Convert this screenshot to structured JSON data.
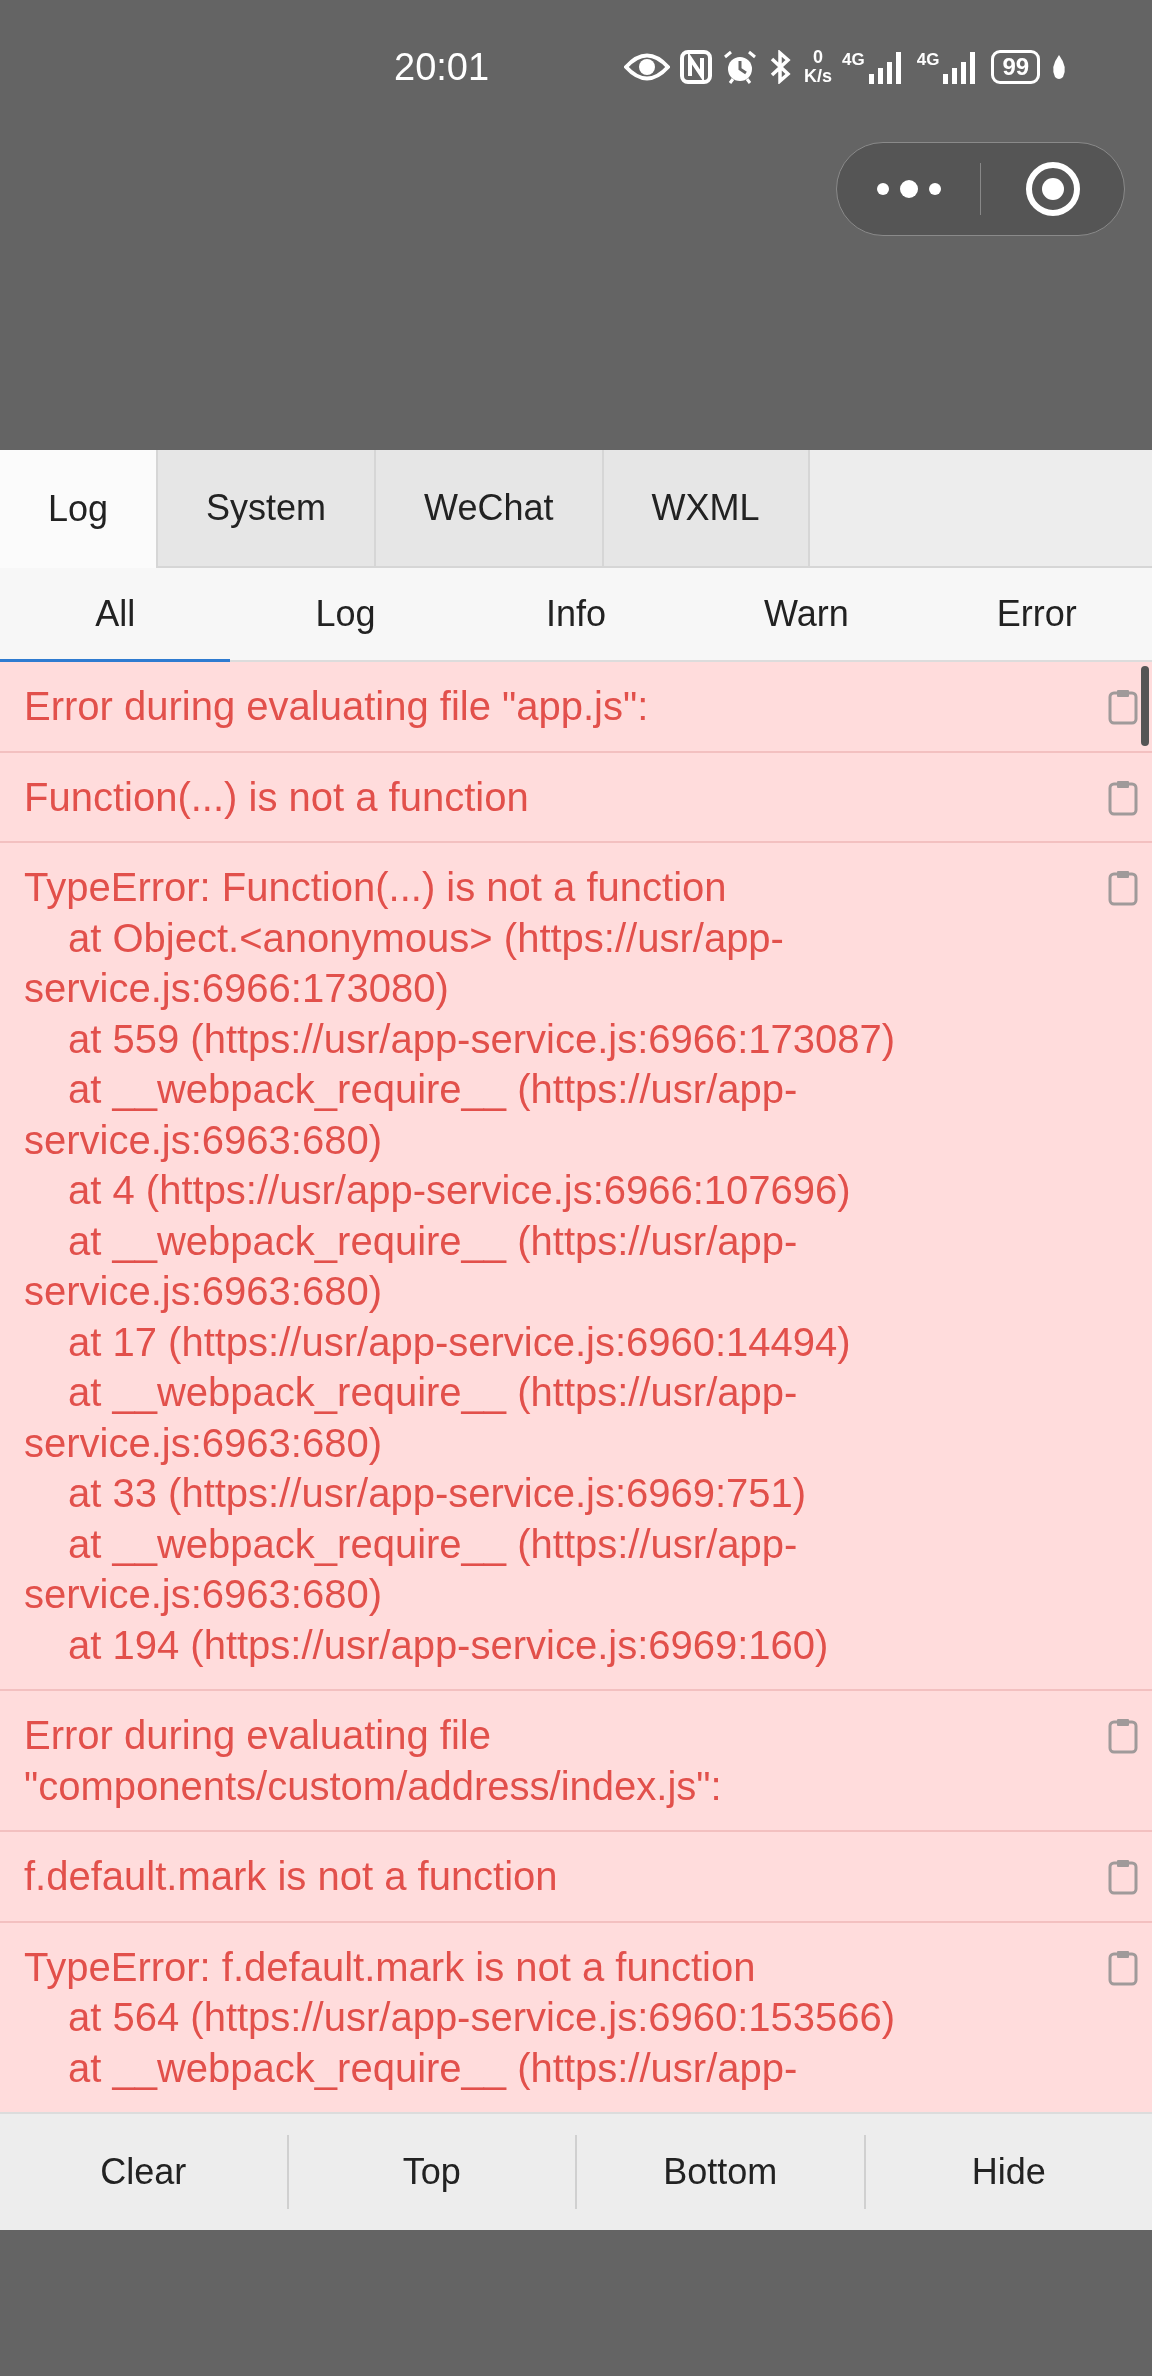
{
  "status_bar": {
    "time": "20:01",
    "net_speed_value": "0",
    "net_speed_unit": "K/s",
    "signal_1_label": "4G",
    "signal_2_label": "4G",
    "battery": "99"
  },
  "top_tabs": [
    {
      "label": "Log",
      "selected": true
    },
    {
      "label": "System",
      "selected": false
    },
    {
      "label": "WeChat",
      "selected": false
    },
    {
      "label": "WXML",
      "selected": false
    }
  ],
  "filter_tabs": [
    {
      "label": "All",
      "selected": true
    },
    {
      "label": "Log",
      "selected": false
    },
    {
      "label": "Info",
      "selected": false
    },
    {
      "label": "Warn",
      "selected": false
    },
    {
      "label": "Error",
      "selected": false
    }
  ],
  "entries": [
    {
      "lines": [
        {
          "text": "Error during evaluating file \"app.js\":",
          "indent": false
        }
      ]
    },
    {
      "lines": [
        {
          "text": "Function(...) is not a function",
          "indent": false
        }
      ]
    },
    {
      "lines": [
        {
          "text": "TypeError: Function(...) is not a function",
          "indent": false
        },
        {
          "text": "at Object.<anonymous> (https://usr/app-",
          "indent": true
        },
        {
          "text": "service.js:6966:173080)",
          "indent": false
        },
        {
          "text": "at 559 (https://usr/app-service.js:6966:173087)",
          "indent": true
        },
        {
          "text": "at __webpack_require__ (https://usr/app-",
          "indent": true
        },
        {
          "text": "service.js:6963:680)",
          "indent": false
        },
        {
          "text": "at 4 (https://usr/app-service.js:6966:107696)",
          "indent": true
        },
        {
          "text": "at __webpack_require__ (https://usr/app-",
          "indent": true
        },
        {
          "text": "service.js:6963:680)",
          "indent": false
        },
        {
          "text": "at 17 (https://usr/app-service.js:6960:14494)",
          "indent": true
        },
        {
          "text": "at __webpack_require__ (https://usr/app-",
          "indent": true
        },
        {
          "text": "service.js:6963:680)",
          "indent": false
        },
        {
          "text": "at 33 (https://usr/app-service.js:6969:751)",
          "indent": true
        },
        {
          "text": "at __webpack_require__ (https://usr/app-",
          "indent": true
        },
        {
          "text": "service.js:6963:680)",
          "indent": false
        },
        {
          "text": "at 194 (https://usr/app-service.js:6969:160)",
          "indent": true
        }
      ]
    },
    {
      "lines": [
        {
          "text": "Error during evaluating file",
          "indent": false
        },
        {
          "text": "\"components/custom/address/index.js\":",
          "indent": false
        }
      ]
    },
    {
      "lines": [
        {
          "text": "f.default.mark is not a function",
          "indent": false
        }
      ]
    },
    {
      "lines": [
        {
          "text": "TypeError: f.default.mark is not a function",
          "indent": false
        },
        {
          "text": "at 564 (https://usr/app-service.js:6960:153566)",
          "indent": true
        },
        {
          "text": "at __webpack_require__ (https://usr/app-",
          "indent": true
        }
      ]
    }
  ],
  "actions": [
    "Clear",
    "Top",
    "Bottom",
    "Hide"
  ]
}
